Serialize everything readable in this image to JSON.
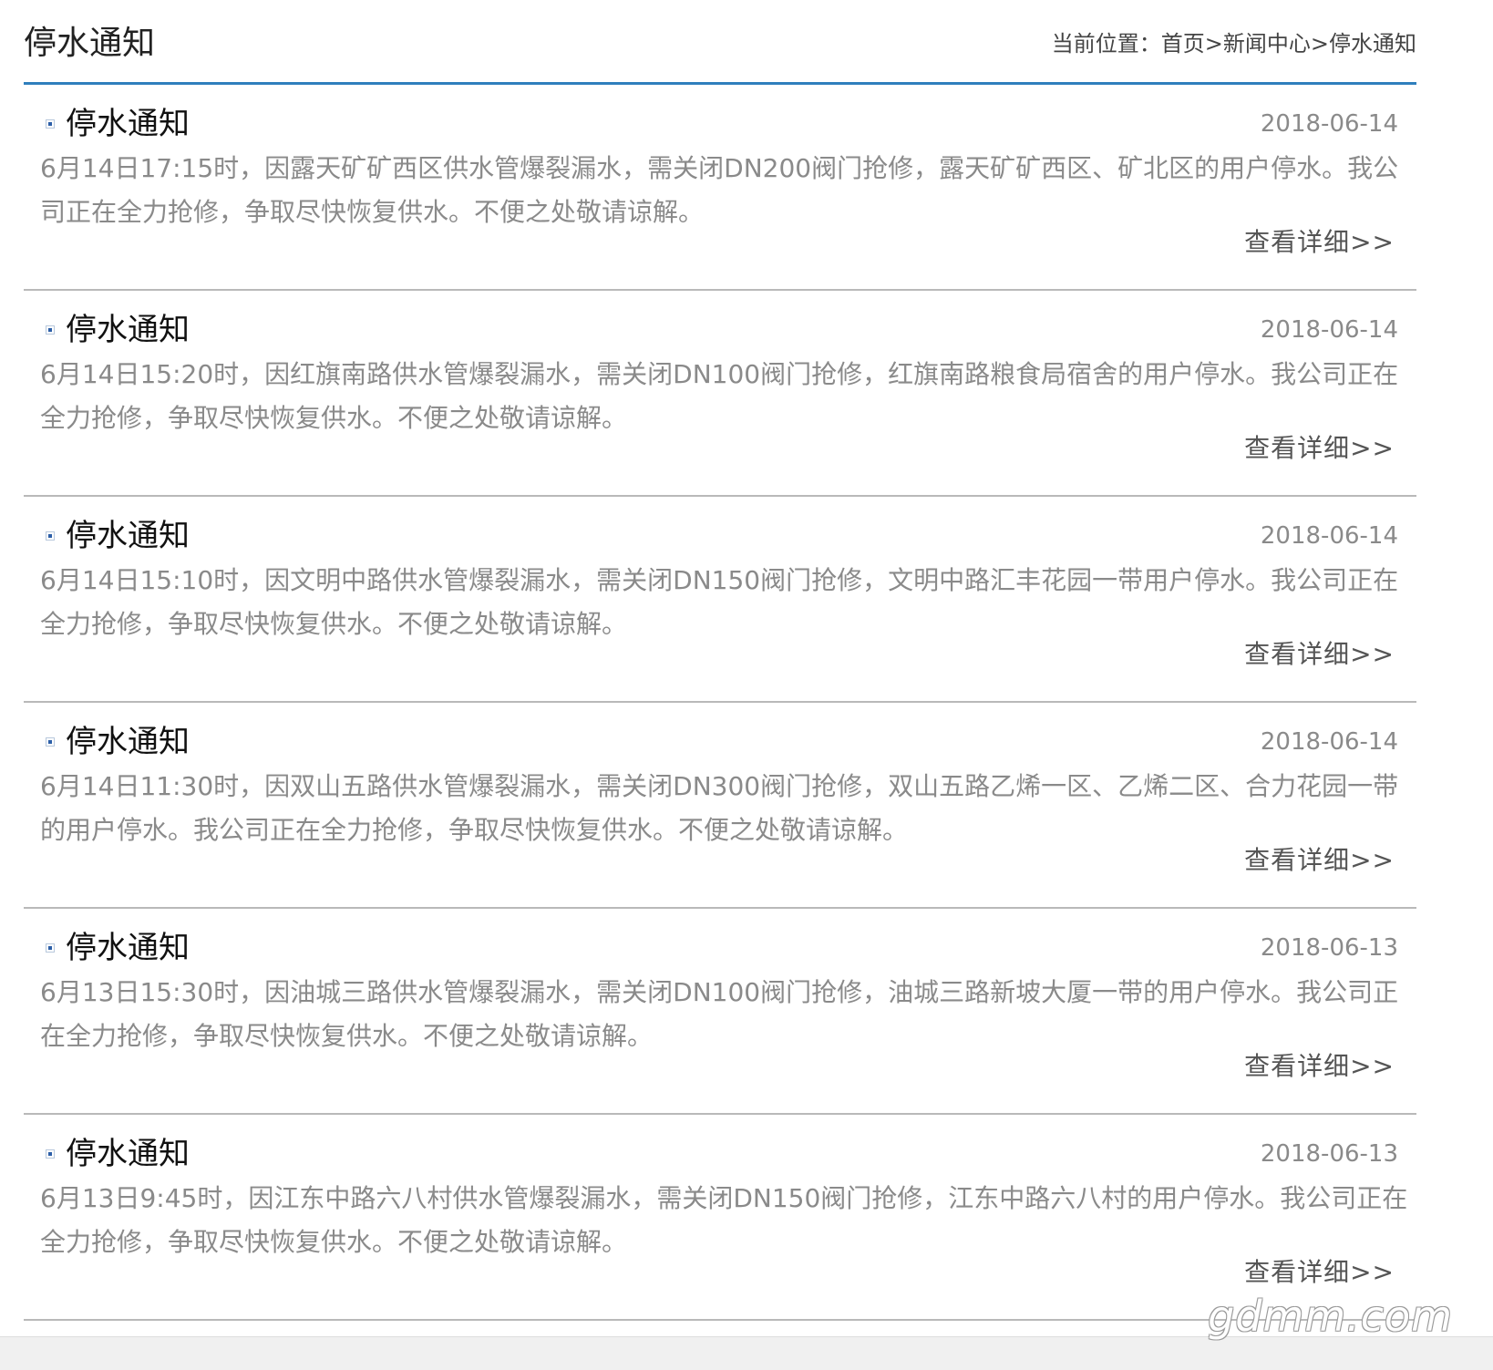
{
  "header": {
    "title": "停水通知",
    "breadcrumb": {
      "prefix": "当前位置：",
      "items": [
        "首页",
        "新闻中心",
        "停水通知"
      ],
      "separator": ">"
    }
  },
  "news": [
    {
      "title": "停水通知",
      "date": "2018-06-14",
      "summary": "6月14日17:15时，因露天矿矿西区供水管爆裂漏水，需关闭DN200阀门抢修，露天矿矿西区、矿北区的用户停水。我公司正在全力抢修，争取尽快恢复供水。不便之处敬请谅解。",
      "more": "查看详细>>"
    },
    {
      "title": "停水通知",
      "date": "2018-06-14",
      "summary": "6月14日15:20时，因红旗南路供水管爆裂漏水，需关闭DN100阀门抢修，红旗南路粮食局宿舍的用户停水。我公司正在全力抢修，争取尽快恢复供水。不便之处敬请谅解。",
      "more": "查看详细>>"
    },
    {
      "title": "停水通知",
      "date": "2018-06-14",
      "summary": "6月14日15:10时，因文明中路供水管爆裂漏水，需关闭DN150阀门抢修，文明中路汇丰花园一带用户停水。我公司正在全力抢修，争取尽快恢复供水。不便之处敬请谅解。",
      "more": "查看详细>>"
    },
    {
      "title": "停水通知",
      "date": "2018-06-14",
      "summary": "6月14日11:30时，因双山五路供水管爆裂漏水，需关闭DN300阀门抢修，双山五路乙烯一区、乙烯二区、合力花园一带的用户停水。我公司正在全力抢修，争取尽快恢复供水。不便之处敬请谅解。",
      "more": "查看详细>>"
    },
    {
      "title": "停水通知",
      "date": "2018-06-13",
      "summary": "6月13日15:30时，因油城三路供水管爆裂漏水，需关闭DN100阀门抢修，油城三路新坡大厦一带的用户停水。我公司正在全力抢修，争取尽快恢复供水。不便之处敬请谅解。",
      "more": "查看详细>>"
    },
    {
      "title": "停水通知",
      "date": "2018-06-13",
      "summary": "6月13日9:45时，因江东中路六八村供水管爆裂漏水，需关闭DN150阀门抢修，江东中路六八村的用户停水。我公司正在全力抢修，争取尽快恢复供水。不便之处敬请谅解。",
      "more": "查看详细>>"
    }
  ],
  "watermark": "gdmm.com",
  "colors": {
    "accent": "#2f7fbd",
    "divider": "#b9b9b9",
    "muted_text": "#8a8a8a"
  }
}
